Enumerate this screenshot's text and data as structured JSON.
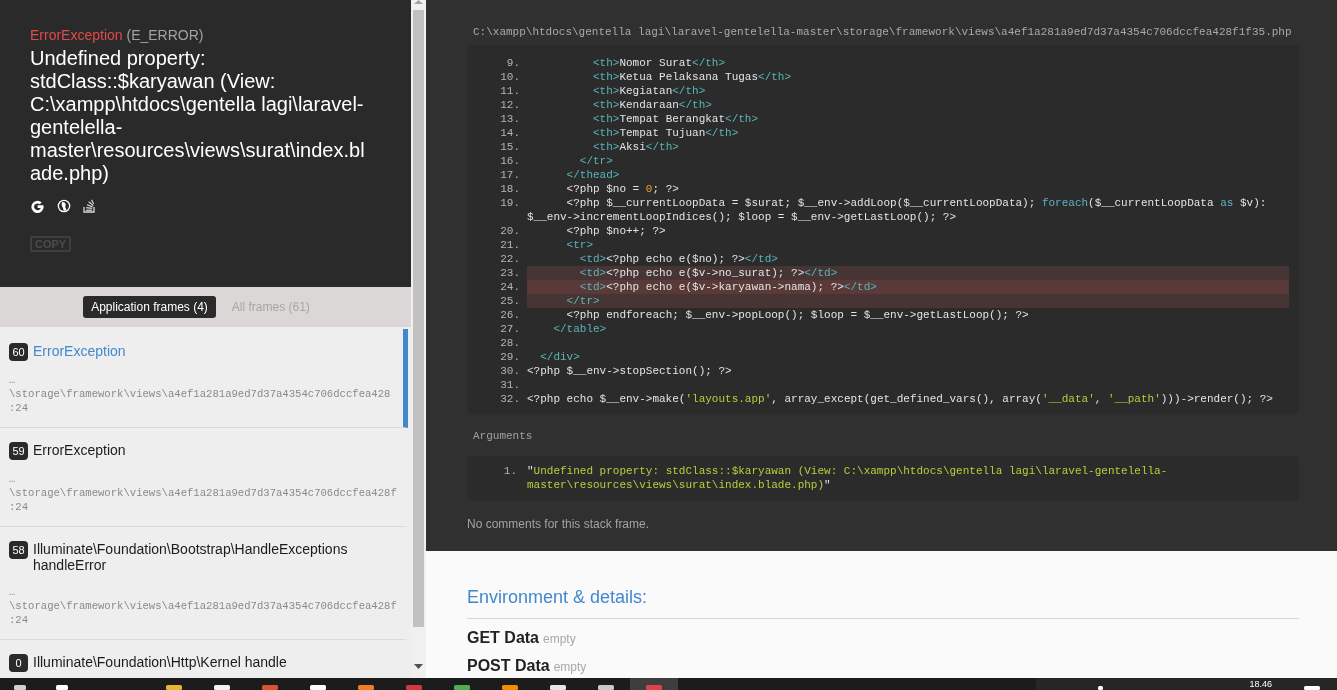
{
  "error": {
    "type": "ErrorException",
    "code": "(E_ERROR)",
    "message": "Undefined property: stdClass::$karyawan (View: C:\\xampp\\htdocs\\gentella lagi\\laravel-gentelella-master\\resources\\views\\surat\\index.blade.php)",
    "copy_button": "COPY"
  },
  "frame_tabs": [
    {
      "label": "Application frames (4)",
      "selected": true
    },
    {
      "label": "All frames (61)",
      "selected": false
    }
  ],
  "frames": [
    {
      "index": "60",
      "class": "ErrorException",
      "ellipsis": "…",
      "file": "\\storage\\framework\\views\\a4ef1a281a9ed7d37a4354c706dccfea428",
      "line": ":24",
      "selected": true
    },
    {
      "index": "59",
      "class": "ErrorException",
      "ellipsis": "…",
      "file": "\\storage\\framework\\views\\a4ef1a281a9ed7d37a4354c706dccfea428f",
      "line": ":24",
      "selected": false
    },
    {
      "index": "58",
      "class": "Illuminate\\Foundation\\Bootstrap\\HandleExceptions",
      "function": "handleError",
      "ellipsis": "…",
      "file": "\\storage\\framework\\views\\a4ef1a281a9ed7d37a4354c706dccfea428f",
      "line": ":24",
      "selected": false
    },
    {
      "index": "0",
      "class": "Illuminate\\Foundation\\Http\\Kernel",
      "function": "handle",
      "selected": false
    }
  ],
  "code_view": {
    "file_path": "C:\\xampp\\htdocs\\gentella lagi\\laravel-gentelella-master\\storage\\framework\\views\\a4ef1a281a9ed7d37a4354c706dccfea428f1f35.php",
    "lines": [
      {
        "number": "9.",
        "kind": "normal",
        "tokens": [
          {
            "text": "          <th>",
            "kind": "tag"
          },
          {
            "text": "Nomor Surat",
            "kind": "plain"
          },
          {
            "text": "</th>",
            "kind": "tag"
          }
        ]
      },
      {
        "number": "10.",
        "kind": "normal",
        "tokens": [
          {
            "text": "          <th>",
            "kind": "tag"
          },
          {
            "text": "Ketua Pelaksana Tugas",
            "kind": "plain"
          },
          {
            "text": "</th>",
            "kind": "tag"
          }
        ]
      },
      {
        "number": "11.",
        "kind": "normal",
        "tokens": [
          {
            "text": "          <th>",
            "kind": "tag"
          },
          {
            "text": "Kegiatan",
            "kind": "plain"
          },
          {
            "text": "</th>",
            "kind": "tag"
          }
        ]
      },
      {
        "number": "12.",
        "kind": "normal",
        "tokens": [
          {
            "text": "          <th>",
            "kind": "tag"
          },
          {
            "text": "Kendaraan",
            "kind": "plain"
          },
          {
            "text": "</th>",
            "kind": "tag"
          }
        ]
      },
      {
        "number": "13.",
        "kind": "normal",
        "tokens": [
          {
            "text": "          <th>",
            "kind": "tag"
          },
          {
            "text": "Tempat Berangkat",
            "kind": "plain"
          },
          {
            "text": "</th>",
            "kind": "tag"
          }
        ]
      },
      {
        "number": "14.",
        "kind": "normal",
        "tokens": [
          {
            "text": "          <th>",
            "kind": "tag"
          },
          {
            "text": "Tempat Tujuan",
            "kind": "plain"
          },
          {
            "text": "</th>",
            "kind": "tag"
          }
        ]
      },
      {
        "number": "15.",
        "kind": "normal",
        "tokens": [
          {
            "text": "          <th>",
            "kind": "tag"
          },
          {
            "text": "Aksi",
            "kind": "plain"
          },
          {
            "text": "</th>",
            "kind": "tag"
          }
        ]
      },
      {
        "number": "16.",
        "kind": "normal",
        "tokens": [
          {
            "text": "        </tr>",
            "kind": "tag"
          }
        ]
      },
      {
        "number": "17.",
        "kind": "normal",
        "tokens": [
          {
            "text": "      </thead>",
            "kind": "tag"
          }
        ]
      },
      {
        "number": "18.",
        "kind": "normal",
        "tokens": [
          {
            "text": "      <?php $no = ",
            "kind": "plain"
          },
          {
            "text": "0",
            "kind": "number"
          },
          {
            "text": "; ?>",
            "kind": "plain"
          }
        ]
      },
      {
        "number": "19.",
        "kind": "normal",
        "tokens": [
          {
            "text": "      <?php $__currentLoopData = $surat; $__env->addLoop($__currentLoopData); ",
            "kind": "plain"
          },
          {
            "text": "foreach",
            "kind": "keyword"
          },
          {
            "text": "($__currentLoopData ",
            "kind": "plain"
          },
          {
            "text": "as",
            "kind": "keyword"
          },
          {
            "text": " $v): $__env->incrementLoopIndices(); $loop = $__env->getLastLoop(); ?>",
            "kind": "plain"
          }
        ]
      },
      {
        "number": "20.",
        "kind": "normal",
        "tokens": [
          {
            "text": "      <?php $no++; ?>",
            "kind": "plain"
          }
        ]
      },
      {
        "number": "21.",
        "kind": "normal",
        "tokens": [
          {
            "text": "      <tr>",
            "kind": "tag"
          }
        ]
      },
      {
        "number": "22.",
        "kind": "normal",
        "tokens": [
          {
            "text": "        <td>",
            "kind": "tag"
          },
          {
            "text": "<?php echo e($no); ?>",
            "kind": "plain"
          },
          {
            "text": "</td>",
            "kind": "tag"
          }
        ]
      },
      {
        "number": "23.",
        "kind": "highlighted",
        "tokens": [
          {
            "text": "        <td>",
            "kind": "tag"
          },
          {
            "text": "<?php echo e($v->no_surat); ?>",
            "kind": "plain"
          },
          {
            "text": "</td>",
            "kind": "tag"
          }
        ]
      },
      {
        "number": "24.",
        "kind": "error",
        "tokens": [
          {
            "text": "        <td>",
            "kind": "tag"
          },
          {
            "text": "<?php echo e($v->karyawan->nama); ?>",
            "kind": "plain"
          },
          {
            "text": "</td>",
            "kind": "tag"
          }
        ]
      },
      {
        "number": "25.",
        "kind": "highlighted",
        "tokens": [
          {
            "text": "      </tr>",
            "kind": "tag"
          }
        ]
      },
      {
        "number": "26.",
        "kind": "normal",
        "tokens": [
          {
            "text": "      <?php endforeach; $__env->popLoop(); $loop = $__env->getLastLoop(); ?>",
            "kind": "plain"
          }
        ]
      },
      {
        "number": "27.",
        "kind": "normal",
        "tokens": [
          {
            "text": "    </table>",
            "kind": "tag"
          }
        ]
      },
      {
        "number": "28.",
        "kind": "normal"
      },
      {
        "number": "29.",
        "kind": "normal",
        "tokens": [
          {
            "text": "  </div>",
            "kind": "tag"
          }
        ]
      },
      {
        "number": "30.",
        "kind": "normal",
        "tokens": [
          {
            "text": "<?php $__env->stopSection(); ?>",
            "kind": "plain"
          }
        ]
      },
      {
        "number": "31.",
        "kind": "normal"
      },
      {
        "number": "32.",
        "kind": "normal",
        "tokens": [
          {
            "text": "<?php echo $__env->make(",
            "kind": "plain"
          },
          {
            "text": "'layouts.app'",
            "kind": "string"
          },
          {
            "text": ", array_except(get_defined_vars(), array(",
            "kind": "plain"
          },
          {
            "text": "'__data'",
            "kind": "string"
          },
          {
            "text": ", ",
            "kind": "plain"
          },
          {
            "text": "'__path'",
            "kind": "string"
          },
          {
            "text": ")))->render(); ?>",
            "kind": "plain"
          }
        ]
      }
    ]
  },
  "arguments": {
    "title": "Arguments",
    "items": [
      {
        "number": "1.",
        "tokens": [
          {
            "text": "\"",
            "kind": "plain"
          },
          {
            "text": "Undefined property: stdClass::$karyawan (View: C:\\xampp\\htdocs\\gentella lagi\\laravel-gentelella-master\\resources\\views\\surat\\index.blade.php)",
            "kind": "string"
          },
          {
            "text": "\"",
            "kind": "plain"
          }
        ]
      }
    ]
  },
  "comments": "No comments for this stack frame.",
  "environment": {
    "title": "Environment & details:",
    "sections": [
      {
        "label": "GET Data",
        "value": "empty"
      },
      {
        "label": "POST Data",
        "value": "empty"
      }
    ]
  },
  "taskbar": {
    "system": [
      {
        "color": "#d0d0d0"
      },
      {
        "color": "#ffffff"
      }
    ],
    "apps": [
      {
        "color": "#e8b530",
        "selected": false
      },
      {
        "color": "#f2f2f2",
        "selected": false
      },
      {
        "color": "#d9542c",
        "selected": false
      },
      {
        "color": "#ffffff",
        "selected": false
      },
      {
        "color": "#f07c26",
        "selected": false
      },
      {
        "color": "#d23a3a",
        "selected": false
      },
      {
        "color": "#4caf50",
        "selected": false
      },
      {
        "color": "#f28c00",
        "selected": false
      },
      {
        "color": "#e6e6e6",
        "selected": false
      },
      {
        "color": "#c8c8c8",
        "selected": false
      },
      {
        "color": "#e04343",
        "selected": true
      }
    ],
    "tray": [
      {
        "color": "#ffffff"
      }
    ],
    "clock": "18.46",
    "notifications": [
      {
        "color": "#ffffff"
      }
    ]
  }
}
